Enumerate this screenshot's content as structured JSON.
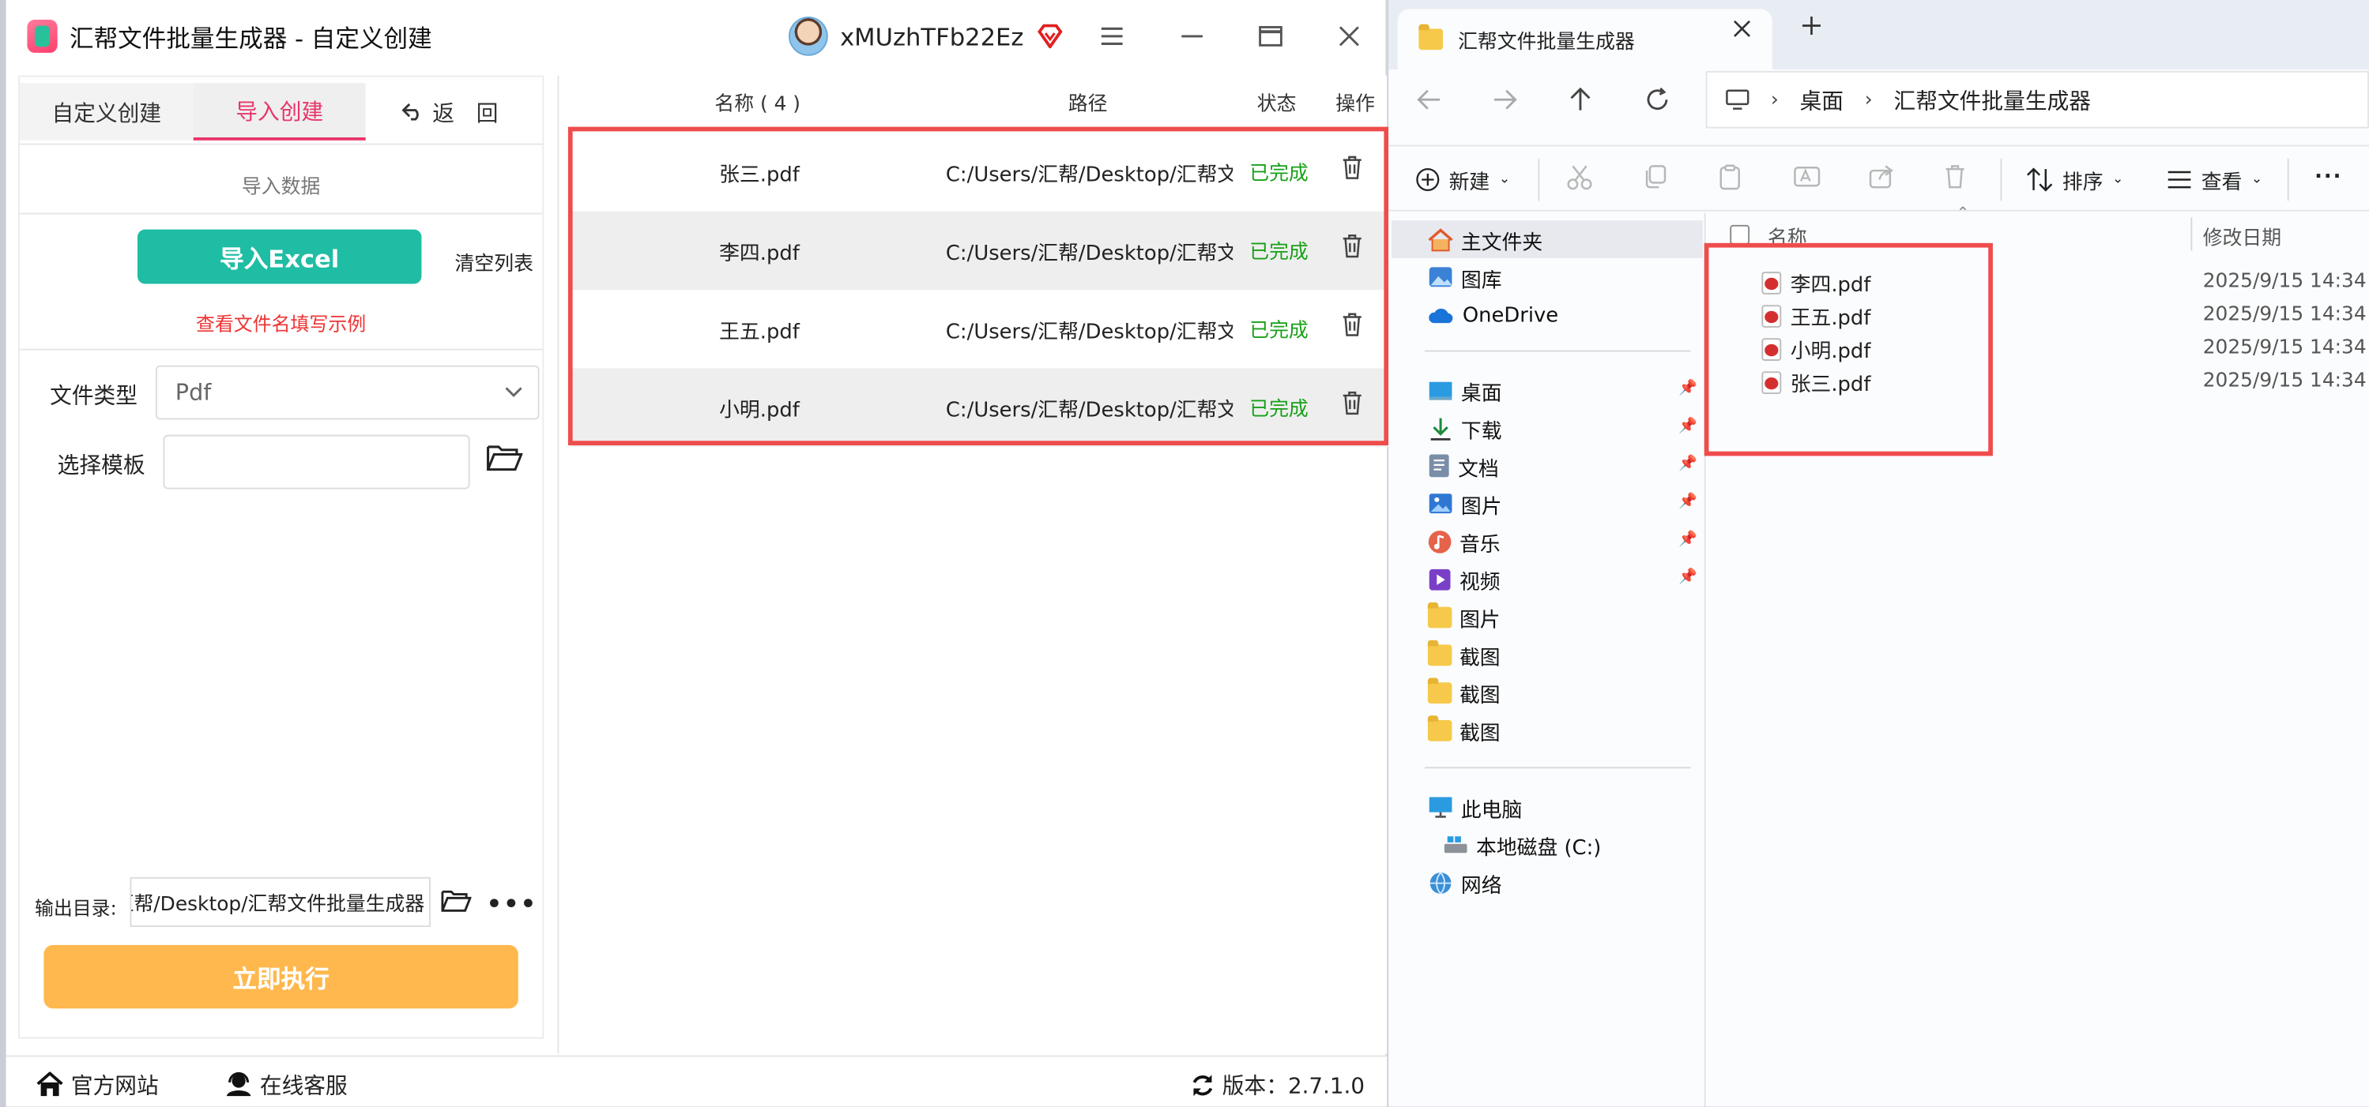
{
  "app": {
    "title": "汇帮文件批量生成器 - 自定义创建",
    "username": "xMUzhTFb22Ez",
    "tabs": {
      "custom": "自定义创建",
      "import": "导入创建",
      "back": "返　回"
    },
    "import_data_label": "导入数据",
    "import_excel_label": "导入Excel",
    "clear_list_label": "清空列表",
    "example_link": "查看文件名填写示例",
    "file_type_label": "文件类型",
    "file_type_value": "Pdf",
    "template_label": "选择模板",
    "template_value": "",
    "output_label": "输出目录:",
    "output_path": "C:/Users/汇帮/Desktop/汇帮文件批量生成器",
    "run_label": "立即执行",
    "list": {
      "headers": {
        "name": "名称 ( 4 )",
        "path": "路径",
        "status": "状态",
        "action": "操作"
      },
      "rows": [
        {
          "name": "张三.pdf",
          "path": "C:/Users/汇帮/Desktop/汇帮文件批量生成器",
          "status": "已完成"
        },
        {
          "name": "李四.pdf",
          "path": "C:/Users/汇帮/Desktop/汇帮文件批量生成器",
          "status": "已完成"
        },
        {
          "name": "王五.pdf",
          "path": "C:/Users/汇帮/Desktop/汇帮文件批量生成器",
          "status": "已完成"
        },
        {
          "name": "小明.pdf",
          "path": "C:/Users/汇帮/Desktop/汇帮文件批量生成器",
          "status": "已完成"
        }
      ]
    },
    "footer": {
      "website": "官方网站",
      "support": "在线客服",
      "version": "版本：2.7.1.0"
    },
    "colors": {
      "accent": "#e8356a",
      "excel_button": "#1fbda4",
      "run_button": "#ffb84d",
      "status_done": "#18a018",
      "highlight": "#ef4c4c"
    }
  },
  "explorer": {
    "tab_title": "汇帮文件批量生成器",
    "breadcrumb": [
      "桌面",
      "汇帮文件批量生成器"
    ],
    "toolbar": {
      "new": "新建",
      "sort": "排序",
      "view": "查看"
    },
    "nav": {
      "home": "主文件夹",
      "gallery": "图库",
      "onedrive": "OneDrive",
      "quick": [
        "桌面",
        "下载",
        "文档",
        "图片",
        "音乐",
        "视频"
      ],
      "folders": [
        "图片",
        "截图",
        "截图",
        "截图"
      ],
      "this_pc": "此电脑",
      "local_disk": "本地磁盘 (C:)",
      "network": "网络"
    },
    "columns": {
      "name": "名称",
      "date": "修改日期"
    },
    "files": [
      {
        "name": "李四.pdf",
        "date": "2025/9/15 14:34"
      },
      {
        "name": "王五.pdf",
        "date": "2025/9/15 14:34"
      },
      {
        "name": "小明.pdf",
        "date": "2025/9/15 14:34"
      },
      {
        "name": "张三.pdf",
        "date": "2025/9/15 14:34"
      }
    ]
  }
}
